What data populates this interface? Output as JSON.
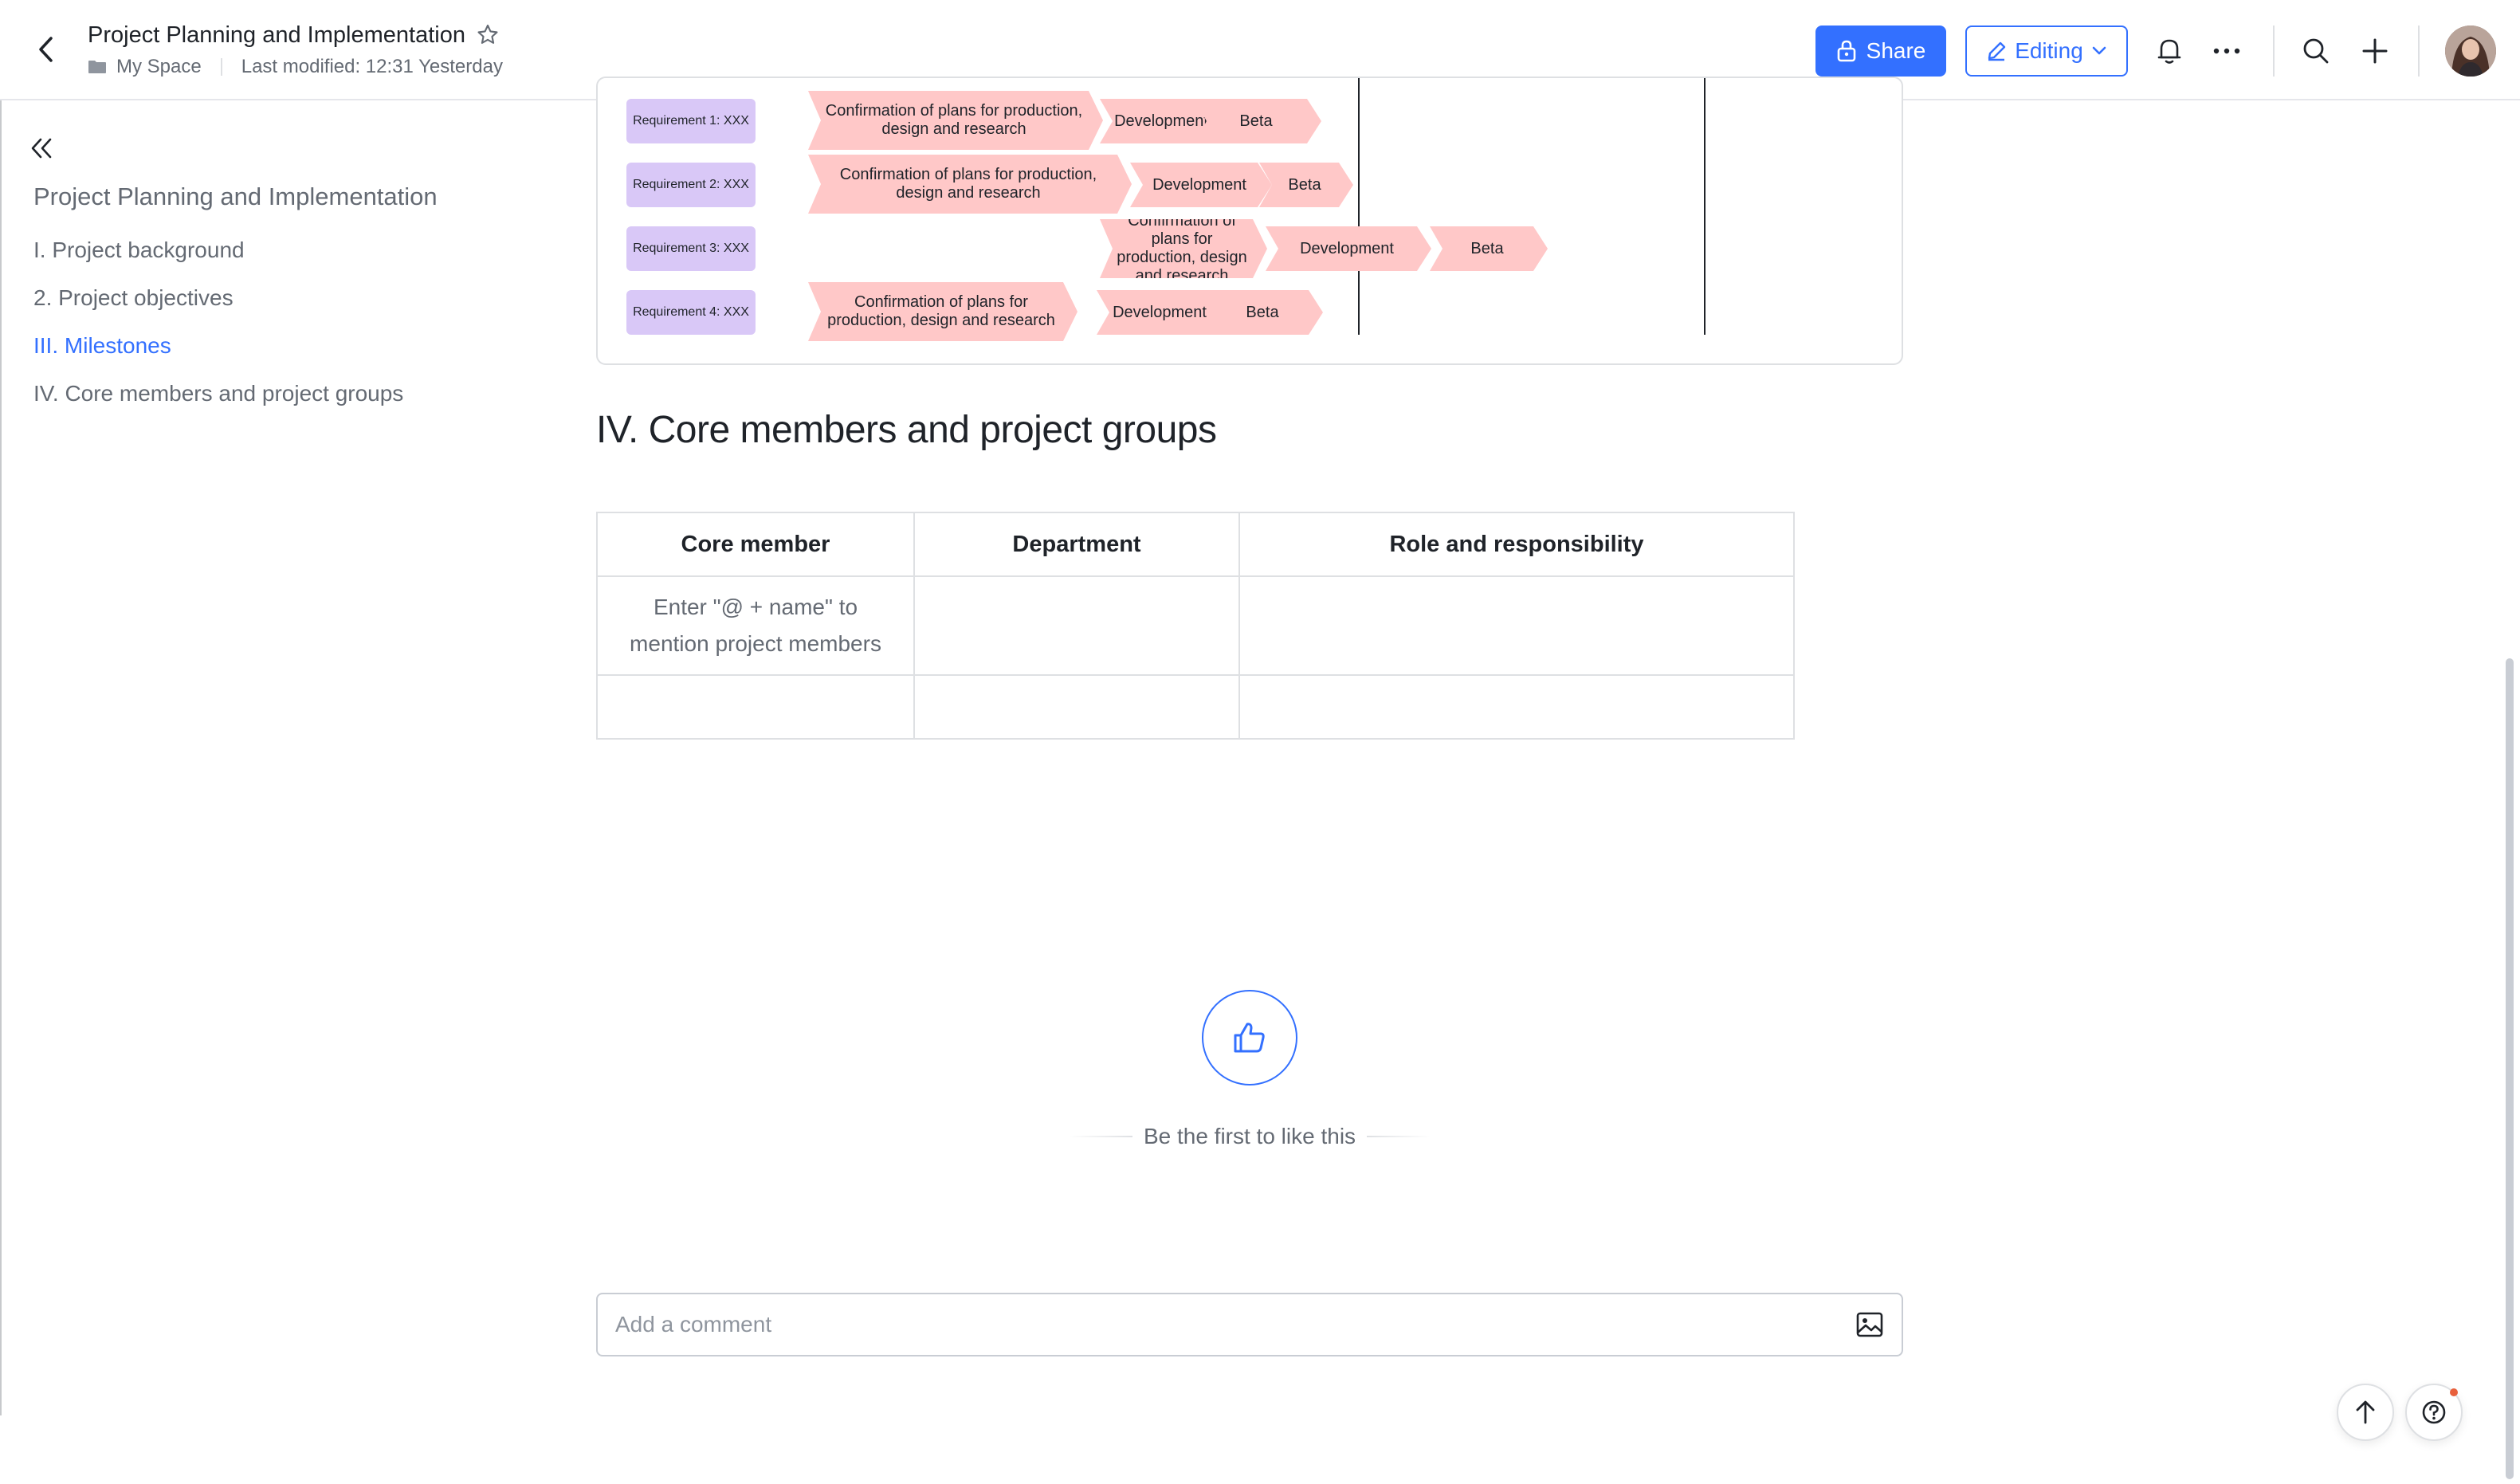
{
  "header": {
    "title": "Project Planning and Implementation",
    "location": "My Space",
    "last_modified": "Last modified: 12:31 Yesterday",
    "share_label": "Share",
    "editing_label": "Editing"
  },
  "outline": {
    "title": "Project Planning and Implementation",
    "items": [
      {
        "label": "I. Project background"
      },
      {
        "label": "2. Project objectives"
      },
      {
        "label": "III. Milestones"
      },
      {
        "label": "IV. Core members and project groups"
      }
    ]
  },
  "gantt": {
    "rows": [
      {
        "requirement": "Requirement 1: XXX",
        "phases": [
          "Confirmation of plans for production, design and research",
          "Development",
          "Beta"
        ]
      },
      {
        "requirement": "Requirement 2: XXX",
        "phases": [
          "Confirmation of plans for production, design and research",
          "Development",
          "Beta"
        ]
      },
      {
        "requirement": "Requirement 3: XXX",
        "phases": [
          "Confirmation of plans for production, design and research",
          "Development",
          "Beta"
        ]
      },
      {
        "requirement": "Requirement 4: XXX",
        "phases": [
          "Confirmation of plans for production, design and research",
          "Development",
          "Beta"
        ]
      }
    ]
  },
  "section": {
    "heading": "IV. Core members and project groups"
  },
  "table": {
    "headers": [
      "Core member",
      "Department",
      "Role and responsibility"
    ],
    "rows": [
      [
        "Enter \"@ + name\" to mention project members",
        "",
        ""
      ],
      [
        "",
        "",
        ""
      ]
    ]
  },
  "like": {
    "text": "Be the first to like this"
  },
  "comment": {
    "placeholder": "Add a comment"
  },
  "colors": {
    "accent": "#3370ff",
    "requirement_tag": "#d9c8f7",
    "phase_chevron": "#ffc8c8",
    "notification_dot": "#e8603c"
  },
  "icons": [
    "back-arrow-icon",
    "star-icon",
    "folder-icon",
    "lock-icon",
    "pencil-icon",
    "chevron-down-icon",
    "bell-icon",
    "more-icon",
    "search-icon",
    "plus-icon",
    "collapse-icon",
    "thumbs-up-icon",
    "image-icon",
    "arrow-up-icon",
    "help-icon"
  ]
}
